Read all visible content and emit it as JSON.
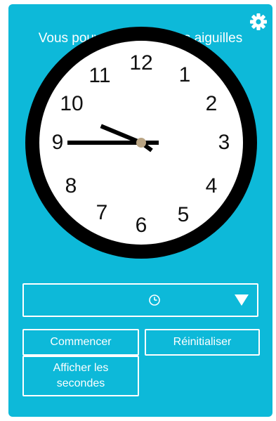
{
  "header": {
    "hint_text": "Vous pouvez déplacer les aiguilles",
    "settings_icon": "gear-icon"
  },
  "clock": {
    "numbers": [
      "12",
      "1",
      "2",
      "3",
      "4",
      "5",
      "6",
      "7",
      "8",
      "9",
      "10",
      "11"
    ],
    "time": {
      "hour": 9,
      "minute": 45
    },
    "face_color": "#ffffff",
    "rim_color": "#000000",
    "center_color": "#b9a483"
  },
  "mode_select": {
    "icon": "clock-icon",
    "dropdown_icon": "triangle-down-icon"
  },
  "buttons": {
    "start_label": "Commencer",
    "reset_label": "Réinitialiser",
    "seconds_label": "Afficher les secondes"
  },
  "colors": {
    "background": "#0db9d9",
    "foreground": "#ffffff"
  }
}
